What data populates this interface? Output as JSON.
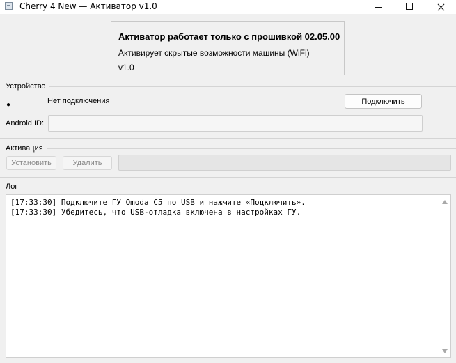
{
  "window": {
    "title": "Cherry 4 New — Активатор v1.0"
  },
  "info": {
    "heading": "Активатор работает только с прошивкой 02.05.00",
    "subtitle": "Активирует скрытые возможности машины (WiFi)",
    "version": "v1.0"
  },
  "device": {
    "section_label": "Устройство",
    "status_dot": "●",
    "status_text": "Нет подключения",
    "connect_label": "Подключить",
    "android_id_label": "Android ID:",
    "android_id_value": ""
  },
  "activation": {
    "section_label": "Активация",
    "install_label": "Установить",
    "remove_label": "Удалить",
    "progress": 0
  },
  "log": {
    "section_label": "Лог",
    "lines": [
      "[17:33:30] Подключите ГУ Omoda C5 по USB и нажмите «Подключить».",
      "[17:33:30] Убедитесь, что USB-отладка включена в настройках ГУ."
    ]
  },
  "icons": {
    "app": "app-window-icon",
    "minimize": "minimize-icon",
    "maximize": "maximize-icon",
    "close": "close-icon"
  }
}
